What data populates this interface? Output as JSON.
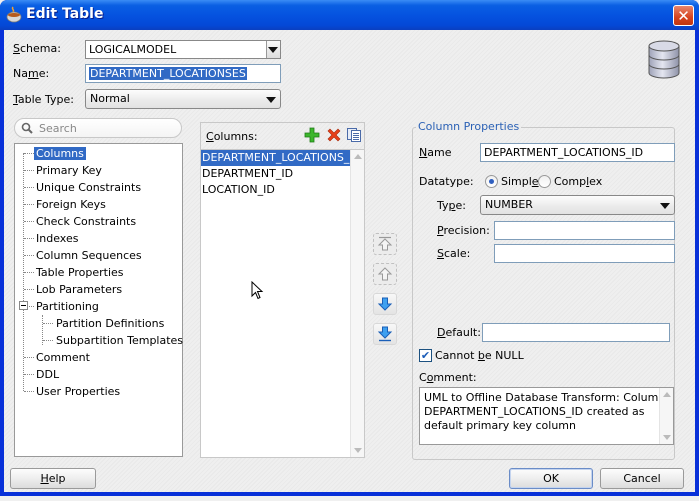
{
  "window": {
    "title": "Edit Table",
    "close_label": "✕"
  },
  "header": {
    "schema_label_pre": "",
    "schema_label_u": "S",
    "schema_label_post": "chema:",
    "schema_value": "LOGICALMODEL",
    "name_label_pre": "Na",
    "name_label_u": "m",
    "name_label_post": "e:",
    "name_value": "DEPARTMENT_LOCATIONSES",
    "table_type_label_u": "T",
    "table_type_label_post": "able Type:",
    "table_type_value": "Normal"
  },
  "search": {
    "placeholder": "Search"
  },
  "tree": {
    "items": [
      {
        "label": "Columns",
        "selected": true
      },
      {
        "label": "Primary Key"
      },
      {
        "label": "Unique Constraints"
      },
      {
        "label": "Foreign Keys"
      },
      {
        "label": "Check Constraints"
      },
      {
        "label": "Indexes"
      },
      {
        "label": "Column Sequences"
      },
      {
        "label": "Table Properties"
      },
      {
        "label": "Lob Parameters"
      },
      {
        "label": "Partitioning",
        "expanded": true
      },
      {
        "label": "Partition Definitions",
        "child": true
      },
      {
        "label": "Subpartition Templates",
        "child": true
      },
      {
        "label": "Comment"
      },
      {
        "label": "DDL"
      },
      {
        "label": "User Properties"
      }
    ]
  },
  "columns_panel": {
    "label_u": "C",
    "label_post": "olumns:",
    "add_icon": "add-icon",
    "delete_icon": "delete-icon",
    "copy_icon": "copy-icon",
    "items": [
      "DEPARTMENT_LOCATIONS_ID",
      "DEPARTMENT_ID",
      "LOCATION_ID"
    ],
    "selected_index": 0
  },
  "move_buttons": [
    {
      "name": "move-top",
      "enabled": false
    },
    {
      "name": "move-up",
      "enabled": false
    },
    {
      "name": "move-down",
      "enabled": true
    },
    {
      "name": "move-bottom",
      "enabled": true
    }
  ],
  "column_properties": {
    "title": "Column Properties",
    "name_label_u": "N",
    "name_label_post": "ame",
    "name_value": "DEPARTMENT_LOCATIONS_ID",
    "datatype_label": "Datatype:",
    "simple_label_pre": "Simpl",
    "simple_label_u": "e",
    "complex_label_pre": "Comp",
    "complex_label_u": "l",
    "complex_label_post": "ex",
    "datatype_selected": "Simple",
    "type_label_pre": "Ty",
    "type_label_u": "p",
    "type_label_post": "e:",
    "type_value": "NUMBER",
    "precision_label_u": "P",
    "precision_label_post": "recision:",
    "precision_value": "",
    "scale_label_u": "S",
    "scale_label_post": "cale:",
    "scale_value": "",
    "default_label_u": "D",
    "default_label_post": "efault:",
    "default_value": "",
    "not_null_label_pre": "Cannot ",
    "not_null_label_u": "b",
    "not_null_label_post": "e NULL",
    "not_null_checked": true,
    "check_mark": "✔",
    "comment_label_pre": "C",
    "comment_label_u": "o",
    "comment_label_post": "mment:",
    "comment_lines": [
      "UML to Offline Database Transform: Column",
      "DEPARTMENT_LOCATIONS_ID created as",
      "default primary key column"
    ]
  },
  "footer": {
    "help_u": "H",
    "help_post": "elp",
    "ok_label": "OK",
    "cancel_label": "Cancel"
  }
}
